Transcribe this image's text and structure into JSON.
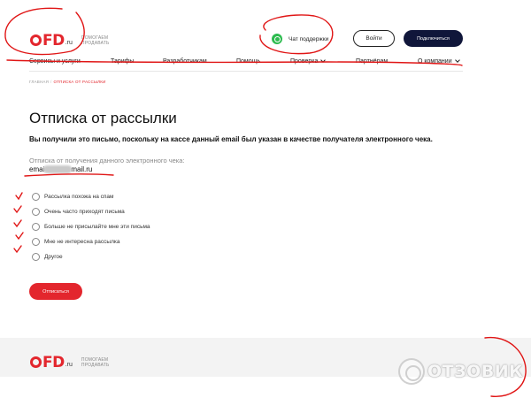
{
  "header": {
    "logo_text": "OFD",
    "logo_tld": ".ru",
    "tagline_line1": "ПОМОГАЕМ",
    "tagline_line2": "ПРОДАВАТЬ",
    "support_label": "Чат поддержки",
    "login_label": "Войти",
    "connect_label": "Подключиться"
  },
  "nav": {
    "items": [
      {
        "label": "Сервисы и услуги",
        "dropdown": false
      },
      {
        "label": "Тарифы",
        "dropdown": false
      },
      {
        "label": "Разработчикам",
        "dropdown": false
      },
      {
        "label": "Помощь",
        "dropdown": false
      },
      {
        "label": "Проверка",
        "dropdown": true
      },
      {
        "label": "Партнёрам",
        "dropdown": false
      },
      {
        "label": "О компании",
        "dropdown": true
      }
    ]
  },
  "breadcrumb": {
    "home": "ГЛАВНАЯ",
    "separator": "/",
    "current": "ОТПИСКА ОТ РАССЫЛКИ"
  },
  "main": {
    "title": "Отписка от рассылки",
    "lead": "Вы получили это письмо, поскольку на кассе данный email был указан в качестве получателя электронного чека.",
    "email_label": "Отписка от получения данного электронного чека:",
    "email_prefix": "emai",
    "email_suffix": "mail.ru",
    "options": [
      {
        "label": "Рассылка похожа на спам",
        "checked": false
      },
      {
        "label": "Очень часто приходят письма",
        "checked": false
      },
      {
        "label": "Больше не присылайте мне эти письма",
        "checked": false
      },
      {
        "label": "Мне не интересна рассылка",
        "checked": false
      },
      {
        "label": "Другое",
        "checked": false
      }
    ],
    "unsubscribe_label": "Отписаться"
  },
  "footer": {
    "logo_text": "OFD",
    "logo_tld": ".ru",
    "tagline_line1": "ПОМОГАЕМ",
    "tagline_line2": "ПРОДАВАТЬ"
  },
  "watermark": {
    "text": "ОТЗОВИК"
  },
  "colors": {
    "brand_red": "#e3262d",
    "dark_navy": "#10163a",
    "whatsapp_green": "#2dbb4f",
    "annotation_red": "#e01515"
  }
}
